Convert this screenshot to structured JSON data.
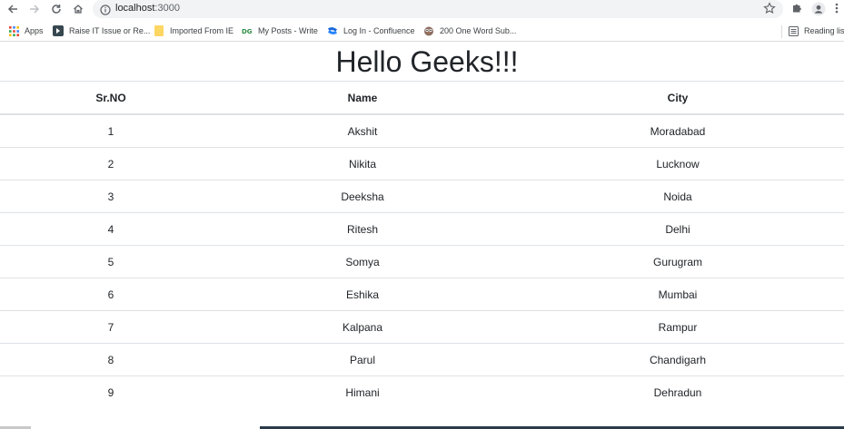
{
  "browser": {
    "url_host": "localhost",
    "url_port": ":3000"
  },
  "bookmarks": [
    {
      "label": "Apps",
      "icon": "apps-grid-icon"
    },
    {
      "label": "Raise IT Issue or Re...",
      "icon": "raise-issue-icon"
    },
    {
      "label": "Imported From IE",
      "icon": "folder-icon"
    },
    {
      "label": "My Posts - Write",
      "icon": "dg-icon"
    },
    {
      "label": "Log In - Confluence",
      "icon": "confluence-icon"
    },
    {
      "label": "200 One Word Sub...",
      "icon": "owl-icon"
    },
    {
      "label": "Reading list",
      "icon": "reading-list-icon"
    }
  ],
  "page": {
    "title": "Hello Geeks!!!"
  },
  "table": {
    "headers": [
      "Sr.NO",
      "Name",
      "City"
    ],
    "rows": [
      [
        "1",
        "Akshit",
        "Moradabad"
      ],
      [
        "2",
        "Nikita",
        "Lucknow"
      ],
      [
        "3",
        "Deeksha",
        "Noida"
      ],
      [
        "4",
        "Ritesh",
        "Delhi"
      ],
      [
        "5",
        "Somya",
        "Gurugram"
      ],
      [
        "6",
        "Eshika",
        "Mumbai"
      ],
      [
        "7",
        "Kalpana",
        "Rampur"
      ],
      [
        "8",
        "Parul",
        "Chandigarh"
      ],
      [
        "9",
        "Himani",
        "Dehradun"
      ]
    ]
  },
  "colors": {
    "text": "#212529",
    "border": "#dee2e6",
    "address_bar": "#f1f3f4"
  }
}
